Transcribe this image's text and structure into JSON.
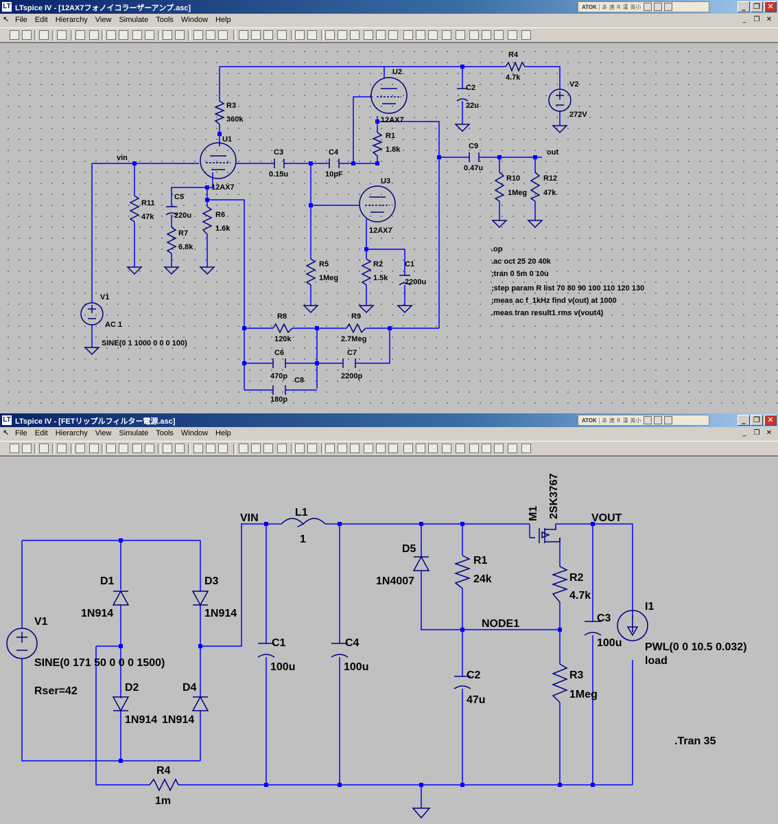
{
  "window_top": {
    "title": "LTspice IV - [12AX7フォノイコラーザーアンプ.asc]",
    "app_icon": "LT",
    "ime": {
      "name": "ATOK",
      "keys": [
        "あ",
        "連",
        "R",
        "漢",
        "英小"
      ]
    },
    "menu": [
      "File",
      "Edit",
      "Hierarchy",
      "View",
      "Simulate",
      "Tools",
      "Window",
      "Help"
    ],
    "schematic": {
      "nets": {
        "vin": "vin",
        "out": "out"
      },
      "components": {
        "R3": {
          "name": "R3",
          "value": "360k"
        },
        "U1": {
          "name": "U1",
          "model": "12AX7"
        },
        "U2": {
          "name": "U2",
          "model": "12AX7"
        },
        "U3": {
          "name": "U3",
          "model": "12AX7"
        },
        "R4": {
          "name": "R4",
          "value": "4.7k"
        },
        "V2": {
          "name": "V2",
          "value": "272V"
        },
        "C2": {
          "name": "C2",
          "value": "22u"
        },
        "R1": {
          "name": "R1",
          "value": "1.8k"
        },
        "C3": {
          "name": "C3",
          "value": "0.15u"
        },
        "C4": {
          "name": "C4",
          "value": "10pF"
        },
        "C9": {
          "name": "C9",
          "value": "0.47u"
        },
        "R10": {
          "name": "R10",
          "value": "1Meg"
        },
        "R12": {
          "name": "R12",
          "value": "47k"
        },
        "R11": {
          "name": "R11",
          "value": "47k"
        },
        "C5": {
          "name": "C5",
          "value": "220u"
        },
        "R7": {
          "name": "R7",
          "value": "6.8k"
        },
        "R6": {
          "name": "R6",
          "value": "1.6k"
        },
        "R5": {
          "name": "R5",
          "value": "1Meg"
        },
        "R2": {
          "name": "R2",
          "value": "1.5k"
        },
        "C1": {
          "name": "C1",
          "value": "2200u"
        },
        "V1": {
          "name": "V1",
          "value1": "AC 1",
          "value2": "SINE(0 1 1000 0 0 0 100)"
        },
        "R8": {
          "name": "R8",
          "value": "120k"
        },
        "R9": {
          "name": "R9",
          "value": "2.7Meg"
        },
        "C6": {
          "name": "C6",
          "value": "470p"
        },
        "C7": {
          "name": "C7",
          "value": "2200p"
        },
        "C8": {
          "name": "C8",
          "value": "180p"
        }
      },
      "directives": [
        ".op",
        ".ac oct 25 20 40k",
        ";tran 0 5m 0 10u",
        ";step param R list 70 80 90 100 110 120 130",
        ";meas ac f_1kHz find v(out) at 1000",
        ".meas tran result1 rms v(vout4)"
      ]
    }
  },
  "window_bottom": {
    "title": "LTspice IV - [FETリップルフィルター電源.asc]",
    "app_icon": "LT",
    "ime": {
      "name": "ATOK",
      "keys": [
        "あ",
        "連",
        "R",
        "漢",
        "英小"
      ]
    },
    "menu": [
      "File",
      "Edit",
      "Hierarchy",
      "View",
      "Simulate",
      "Tools",
      "Window",
      "Help"
    ],
    "schematic": {
      "nets": {
        "vin": "VIN",
        "vout": "VOUT",
        "node1": "NODE1"
      },
      "components": {
        "V1": {
          "name": "V1",
          "value1": "SINE(0 171 50 0 0 0 1500)",
          "value2": "Rser=42"
        },
        "D1": {
          "name": "D1",
          "model": "1N914"
        },
        "D2": {
          "name": "D2",
          "model": "1N914"
        },
        "D3": {
          "name": "D3",
          "model": "1N914"
        },
        "D4": {
          "name": "D4",
          "model": "1N914"
        },
        "L1": {
          "name": "L1",
          "value": "1"
        },
        "C1": {
          "name": "C1",
          "value": "100u"
        },
        "C4": {
          "name": "C4",
          "value": "100u"
        },
        "D5": {
          "name": "D5",
          "model": "1N4007"
        },
        "R1": {
          "name": "R1",
          "value": "24k"
        },
        "M1": {
          "name": "M1",
          "model": "2SK3767"
        },
        "R2": {
          "name": "R2",
          "value": "4.7k"
        },
        "C2": {
          "name": "C2",
          "value": "47u"
        },
        "R3": {
          "name": "R3",
          "value": "1Meg"
        },
        "C3": {
          "name": "C3",
          "value": "100u"
        },
        "I1": {
          "name": "I1",
          "value": "PWL(0 0 10.5 0.032)",
          "value2": "load"
        },
        "R4": {
          "name": "R4",
          "value": "1m"
        }
      },
      "directives": [
        ".Tran 35"
      ]
    }
  },
  "colors": {
    "wire": "#0000ff",
    "component": "#000080",
    "junction": "#0000ff",
    "title_bar": "#0a246a",
    "canvas": "#c0c0c0"
  }
}
